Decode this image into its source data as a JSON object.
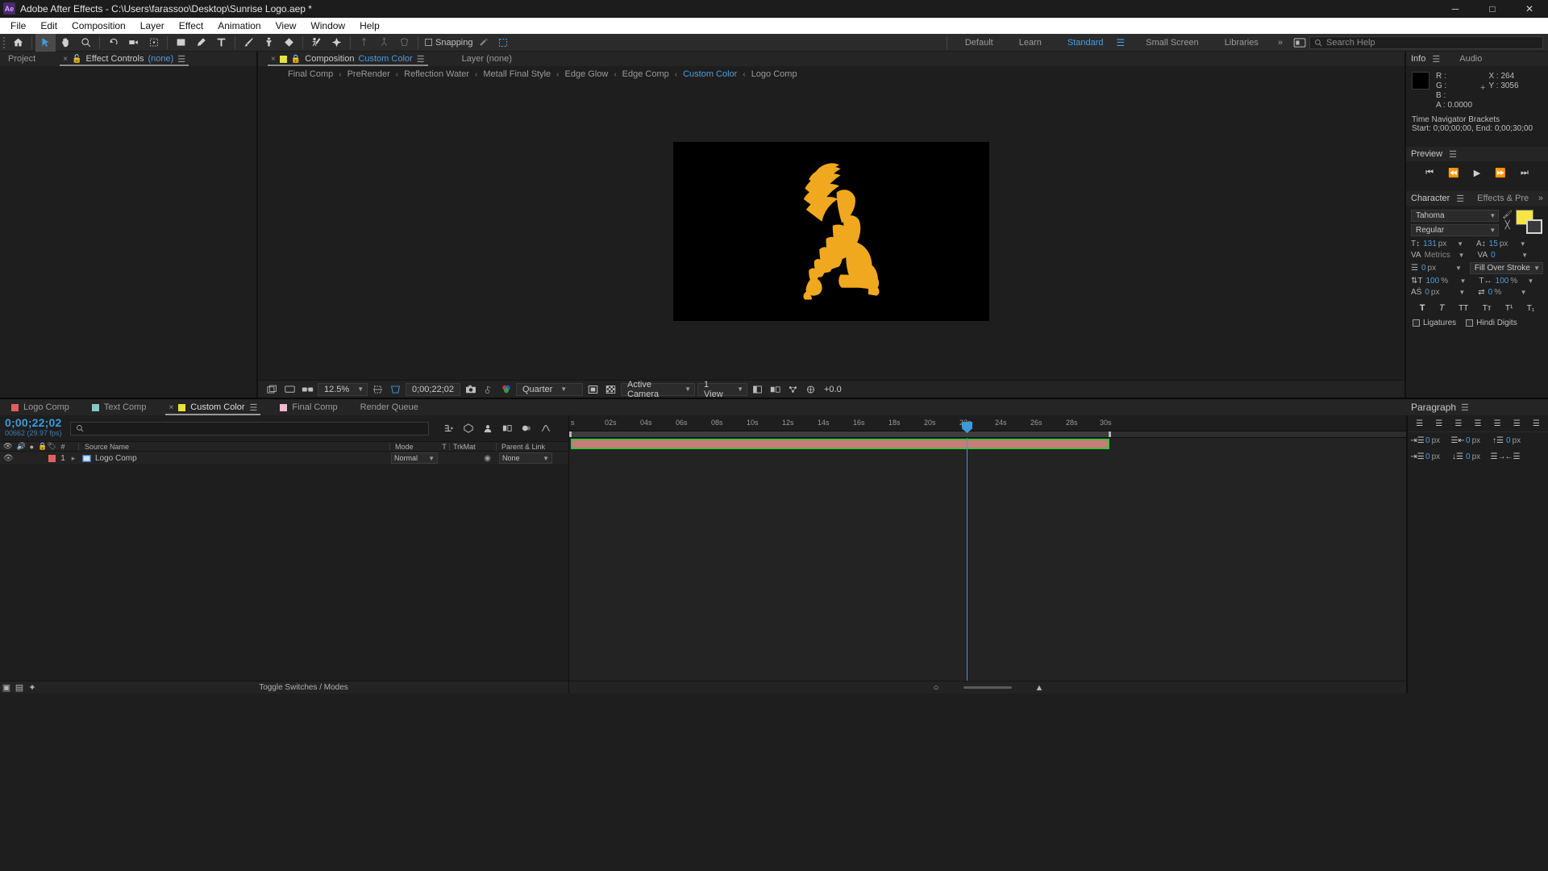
{
  "titlebar": {
    "app_icon": "ae-logo",
    "title": "Adobe After Effects - C:\\Users\\farassoo\\Desktop\\Sunrise Logo.aep *",
    "minimize": "─",
    "maximize": "□",
    "close": "✕"
  },
  "menubar": {
    "items": [
      "File",
      "Edit",
      "Composition",
      "Layer",
      "Effect",
      "Animation",
      "View",
      "Window",
      "Help"
    ]
  },
  "toolbar": {
    "snapping_label": "Snapping",
    "workspaces": [
      {
        "label": "Default",
        "selected": false
      },
      {
        "label": "Learn",
        "selected": false
      },
      {
        "label": "Standard",
        "selected": true
      },
      {
        "label": "Small Screen",
        "selected": false
      },
      {
        "label": "Libraries",
        "selected": false
      }
    ],
    "overflow": "»",
    "search_placeholder": "Search Help"
  },
  "left_panel": {
    "tabs": [
      {
        "label": "Project",
        "active": false,
        "closable": false
      },
      {
        "label": "Effect Controls",
        "suffix": "(none)",
        "active": true,
        "closable": true
      }
    ]
  },
  "composition_panel": {
    "tabs": [
      {
        "label": "Composition",
        "value": "Custom Color",
        "active": true,
        "closable": true
      },
      {
        "label": "Layer (none)",
        "active": false,
        "closable": false
      }
    ],
    "breadcrumb": [
      {
        "label": "Final Comp",
        "selected": false
      },
      {
        "label": "PreRender",
        "selected": false
      },
      {
        "label": "Reflection Water",
        "selected": false
      },
      {
        "label": "Metall Final Style",
        "selected": false
      },
      {
        "label": "Edge Glow",
        "selected": false
      },
      {
        "label": "Edge Comp",
        "selected": false
      },
      {
        "label": "Custom Color",
        "selected": true
      },
      {
        "label": "Logo Comp",
        "selected": false
      }
    ],
    "breadcrumb_separator": "‹",
    "toolbar": {
      "zoom": "12.5%",
      "timecode": "0;00;22;02",
      "resolution": "Quarter",
      "camera": "Active Camera",
      "views": "1 View",
      "exposure": "+0.0"
    },
    "logo_color": "#f0a81e"
  },
  "info_panel": {
    "tabs": [
      "Info",
      "Audio"
    ],
    "channels": [
      "R :",
      "G :",
      "B :",
      "A :"
    ],
    "alpha_value": "0.0000",
    "x_label": "X :",
    "x_value": "264",
    "y_label": "Y :",
    "y_value": "3056",
    "brackets_title": "Time Navigator Brackets",
    "brackets_value": "Start: 0;00;00;00, End: 0;00;30;00"
  },
  "preview_panel": {
    "title": "Preview",
    "buttons": [
      "first-frame",
      "previous-frame",
      "play",
      "next-frame",
      "last-frame"
    ]
  },
  "character_panel": {
    "tabs": [
      "Character",
      "Effects & Pre"
    ],
    "font_family": "Tahoma",
    "font_style": "Regular",
    "font_size": "131",
    "font_size_unit": "px",
    "leading": "15",
    "leading_unit": "px",
    "kerning_label": "Metrics",
    "tracking": "0",
    "stroke_width": "0",
    "stroke_unit": "px",
    "fill_stroke_order": "Fill Over Stroke",
    "vertical_scale": "100",
    "vertical_unit": "%",
    "horizontal_scale": "100",
    "horizontal_unit": "%",
    "baseline_shift": "0",
    "baseline_unit": "px",
    "tsume": "0",
    "tsume_unit": "%",
    "style_buttons": [
      "T",
      "T-italic",
      "TT",
      "Tt",
      "T-sup",
      "T-sub"
    ],
    "ligatures_label": "Ligatures",
    "hindi_label": "Hindi Digits",
    "fill_color": "#f5e642"
  },
  "paragraph_panel": {
    "title": "Paragraph",
    "indent_left": "0",
    "indent_right": "0",
    "indent_first": "0",
    "space_before": "0",
    "space_after": "0",
    "unit": "px"
  },
  "timeline": {
    "tabs": [
      {
        "label": "Logo Comp",
        "color": "#e06060",
        "active": false,
        "closable": false
      },
      {
        "label": "Text Comp",
        "color": "#86c7c9",
        "active": false,
        "closable": false
      },
      {
        "label": "Custom Color",
        "color": "#e8e337",
        "active": true,
        "closable": true
      },
      {
        "label": "Final Comp",
        "color": "#f0b8cf",
        "active": false,
        "closable": false
      },
      {
        "label": "Render Queue",
        "color": null,
        "active": false,
        "closable": false
      }
    ],
    "timecode": "0;00;22;02",
    "frame_info": "00662 (29.97 fps)",
    "search_placeholder": "",
    "columns": [
      "#",
      "Source Name",
      "Mode",
      "T",
      "TrkMat",
      "Parent & Link"
    ],
    "layers": [
      {
        "index": "1",
        "name": "Logo Comp",
        "color": "#e06060",
        "mode": "Normal",
        "trkmat": "",
        "parent": "None",
        "bar_color": "#c97a7a",
        "bar_outline": "#3fbf3f"
      }
    ],
    "ruler_ticks": [
      "s",
      "02s",
      "04s",
      "06s",
      "08s",
      "10s",
      "12s",
      "14s",
      "16s",
      "18s",
      "20s",
      "22s",
      "24s",
      "26s",
      "28s",
      "30s"
    ],
    "footer_label": "Toggle Switches / Modes",
    "playhead_time_percent": 73.4
  }
}
